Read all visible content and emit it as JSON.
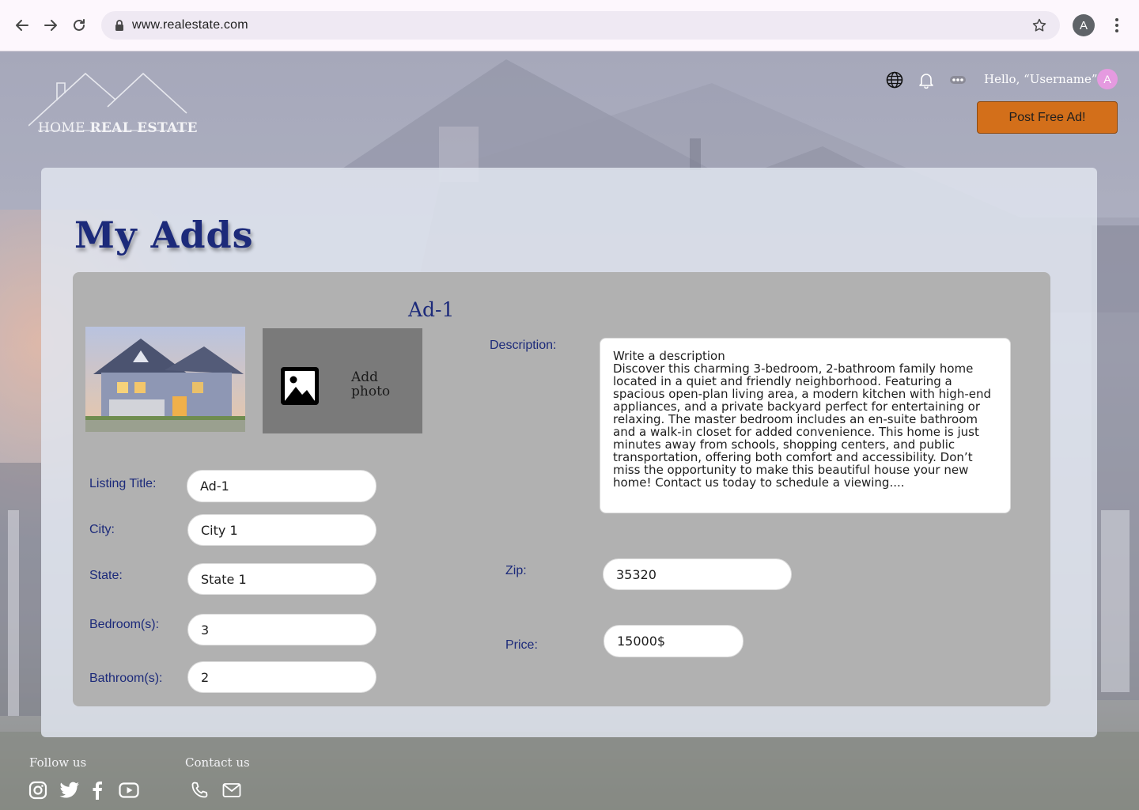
{
  "browser": {
    "url": "www.realestate.com",
    "profile_initial": "A"
  },
  "site": {
    "logo_text_light": "HOME ",
    "logo_text_bold": "REAL ESTATE"
  },
  "header": {
    "greeting": "Hello, “Username”",
    "avatar_initial": "A",
    "post_button": "Post Free Ad!"
  },
  "page": {
    "title": "My Adds"
  },
  "ad": {
    "title": "Ad-1",
    "add_photo_label": "Add photo",
    "fields": {
      "listing_title": {
        "label": "Listing Title:",
        "value": "Ad-1"
      },
      "city": {
        "label": "City:",
        "value": "City 1"
      },
      "state": {
        "label": "State:",
        "value": "State 1"
      },
      "bedrooms": {
        "label": "Bedroom(s):",
        "value": "3"
      },
      "bathrooms": {
        "label": "Bathroom(s):",
        "value": "2"
      },
      "zip": {
        "label": "Zip:",
        "value": "35320"
      },
      "price": {
        "label": "Price:",
        "value": "15000$"
      }
    },
    "description": {
      "label": "Description:",
      "placeholder": "Write a description",
      "value": "Discover this charming 3-bedroom, 2-bathroom family home located in a quiet and friendly neighborhood. Featuring a spacious open-plan living area, a modern kitchen with high-end appliances, and a private backyard perfect for entertaining or relaxing. The master bedroom includes an en-suite bathroom and a walk-in closet for added convenience. This home is just minutes away from schools, shopping centers, and public transportation, offering both comfort and accessibility. Don’t miss the opportunity to make this beautiful house your new home! Contact us today to schedule a viewing...."
    }
  },
  "footer": {
    "follow_label": "Follow us",
    "contact_label": "Contact us"
  },
  "icons": {
    "header": [
      "globe-icon",
      "bell-icon",
      "more-dots-icon"
    ],
    "social": [
      "instagram-icon",
      "twitter-icon",
      "facebook-icon",
      "youtube-icon"
    ],
    "contact": [
      "phone-icon",
      "mail-icon"
    ]
  },
  "colors": {
    "accent_navy": "#1c2a7a",
    "post_button": "#d36f1a",
    "avatar_pink": "#e59ae0",
    "card_gray": "#b1b1b1"
  }
}
